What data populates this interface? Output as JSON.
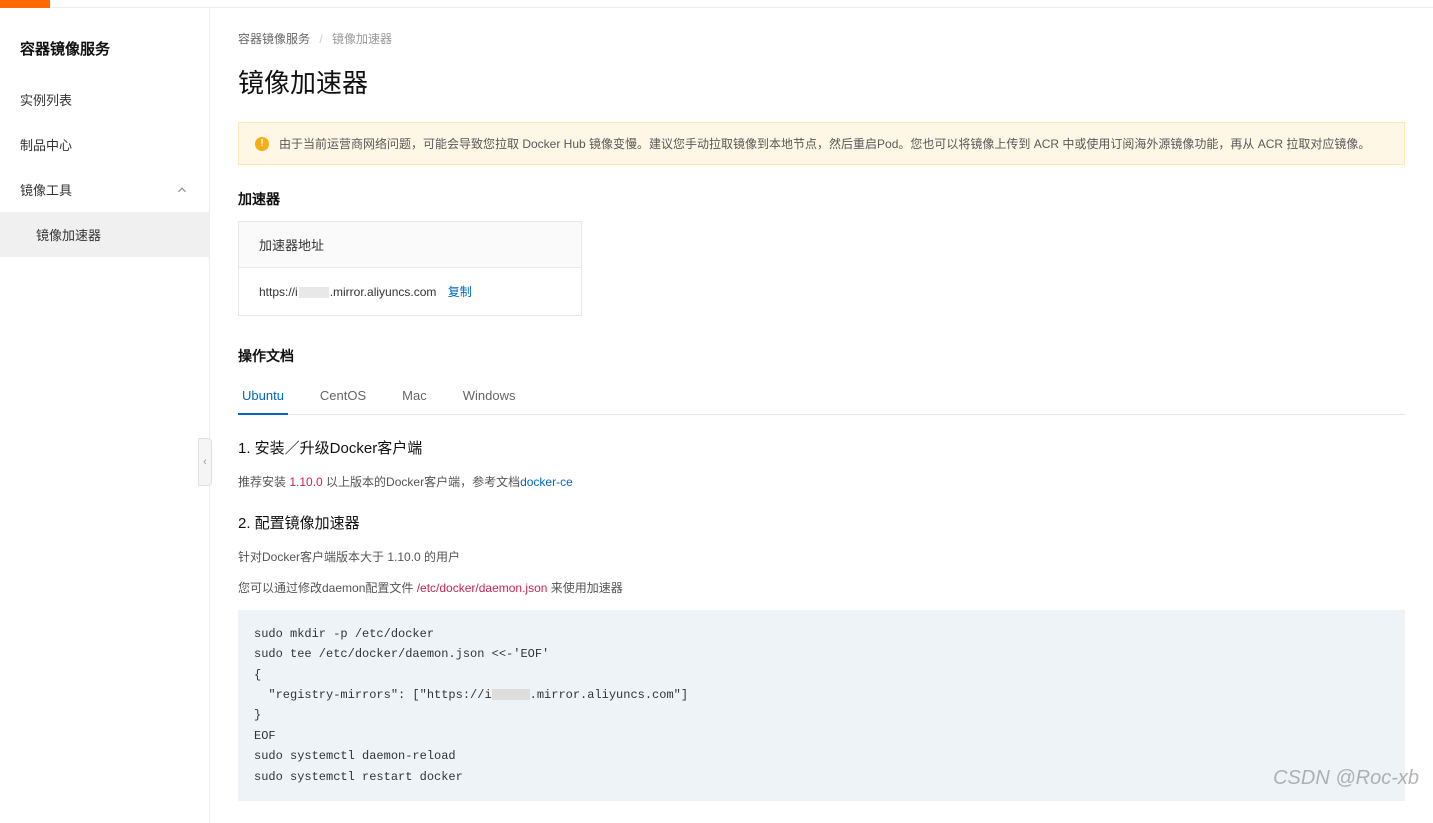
{
  "sidebar": {
    "title": "容器镜像服务",
    "items": [
      {
        "label": "实例列表"
      },
      {
        "label": "制品中心"
      }
    ],
    "group": {
      "label": "镜像工具"
    },
    "sub": {
      "label": "镜像加速器"
    }
  },
  "breadcrumb": {
    "root": "容器镜像服务",
    "current": "镜像加速器"
  },
  "page_title": "镜像加速器",
  "alert": "由于当前运营商网络问题，可能会导致您拉取 Docker Hub 镜像变慢。建议您手动拉取镜像到本地节点，然后重启Pod。您也可以将镜像上传到 ACR 中或使用订阅海外源镜像功能，再从 ACR 拉取对应镜像。",
  "accelerator": {
    "section": "加速器",
    "head": "加速器地址",
    "url_prefix": "https://i",
    "url_suffix": ".mirror.aliyuncs.com",
    "copy": "复制"
  },
  "docs": {
    "section": "操作文档",
    "tabs": [
      "Ubuntu",
      "CentOS",
      "Mac",
      "Windows"
    ],
    "step1_title": "1. 安装／升级Docker客户端",
    "step1_text_a": "推荐安装 ",
    "step1_version": "1.10.0",
    "step1_text_b": " 以上版本的Docker客户端，参考文档",
    "step1_link": "docker-ce",
    "step2_title": "2. 配置镜像加速器",
    "step2_text_a": "针对Docker客户端版本大于 1.10.0 的用户",
    "step2_text_b1": "您可以通过修改daemon配置文件 ",
    "step2_path": "/etc/docker/daemon.json",
    "step2_text_b2": " 来使用加速器",
    "code_pre": "sudo mkdir -p /etc/docker\nsudo tee /etc/docker/daemon.json <<-'EOF'\n{\n  \"registry-mirrors\": [\"https://i",
    "code_post": ".mirror.aliyuncs.com\"]\n}\nEOF\nsudo systemctl daemon-reload\nsudo systemctl restart docker"
  },
  "watermark": "CSDN @Roc-xb"
}
